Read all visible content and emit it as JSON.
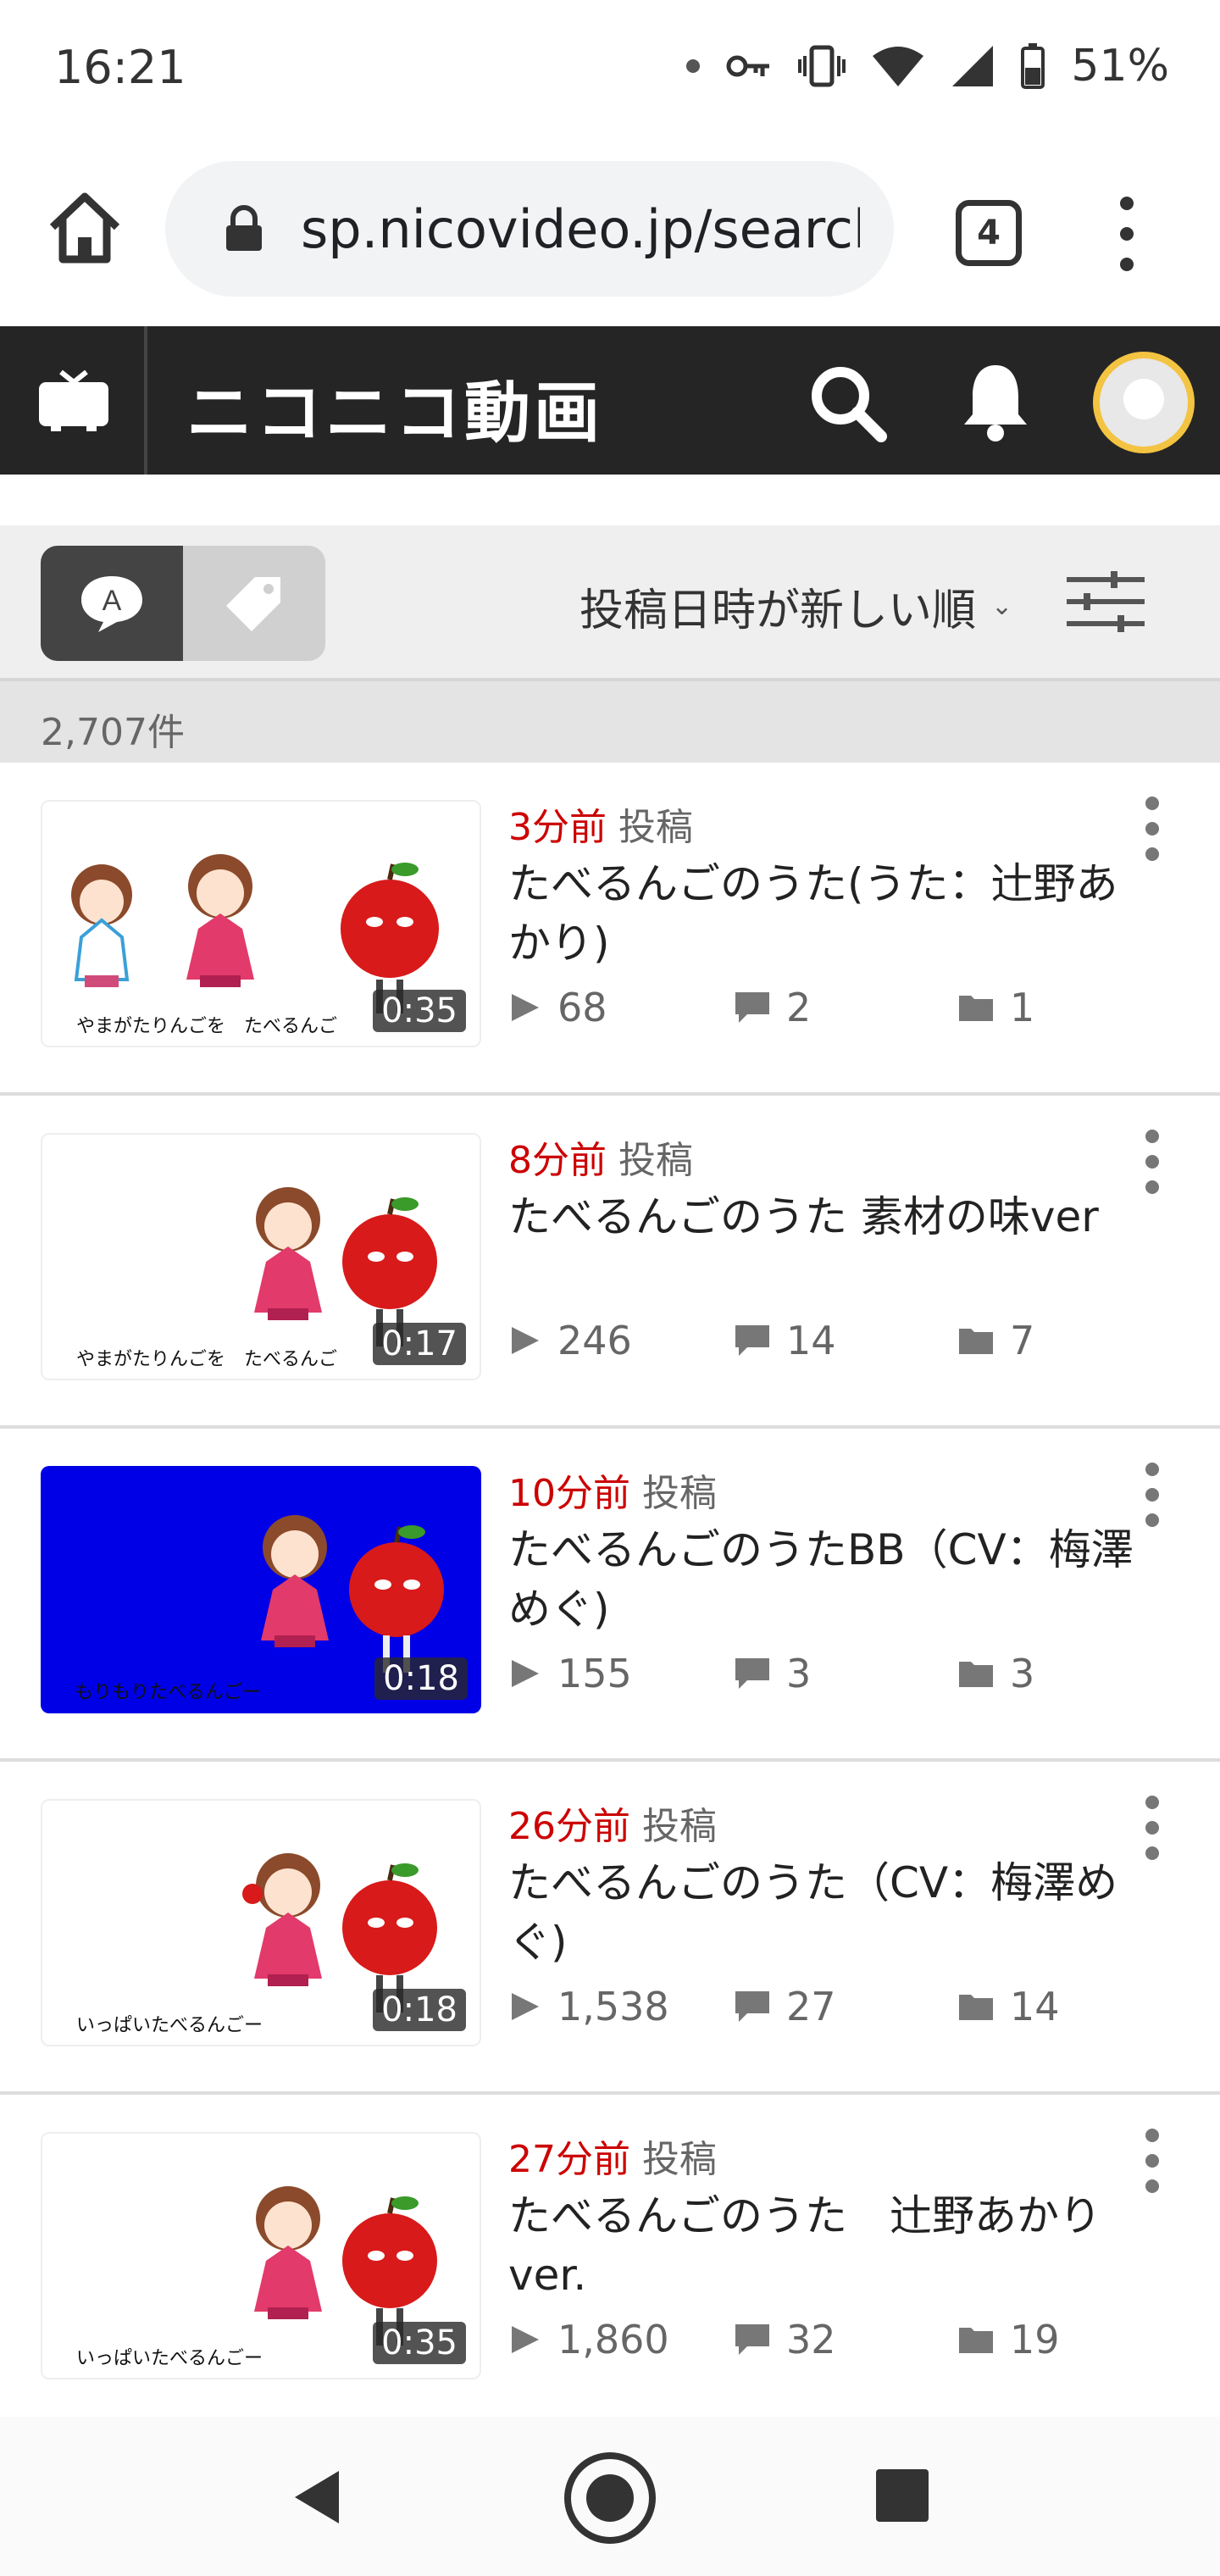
{
  "status_bar": {
    "time": "16:21",
    "battery": "51%",
    "icons": [
      "dot-icon",
      "key-icon",
      "vibrate-icon",
      "wifi-icon",
      "signal-icon",
      "battery-icon"
    ]
  },
  "browser": {
    "url": "sp.nicovideo.jp/search/",
    "tab_count": "4"
  },
  "header": {
    "site_title": "ニコニコ動画",
    "accent_color": "#252525"
  },
  "filter": {
    "sort_label": "投稿日時が新しい順",
    "search_mode_selected": "keyword"
  },
  "results": {
    "count_label": "2,707件",
    "items": [
      {
        "ago": "3分前",
        "posted": "投稿",
        "title": "たべるんごのうた(うた：辻野あかり)",
        "views": "68",
        "comments": "2",
        "mylists": "1",
        "duration": "0:35"
      },
      {
        "ago": "8分前",
        "posted": "投稿",
        "title": "たべるんごのうた 素材の味ver",
        "views": "246",
        "comments": "14",
        "mylists": "7",
        "duration": "0:17"
      },
      {
        "ago": "10分前",
        "posted": "投稿",
        "title": "たべるんごのうたBB（CV：梅澤めぐ)",
        "views": "155",
        "comments": "3",
        "mylists": "3",
        "duration": "0:18"
      },
      {
        "ago": "26分前",
        "posted": "投稿",
        "title": "たべるんごのうた（CV：梅澤めぐ)",
        "views": "1,538",
        "comments": "27",
        "mylists": "14",
        "duration": "0:18"
      },
      {
        "ago": "27分前",
        "posted": "投稿",
        "title": "たべるんごのうた　辻野あかりver.",
        "views": "1,860",
        "comments": "32",
        "mylists": "19",
        "duration": "0:35"
      }
    ]
  },
  "colors": {
    "time_red": "#cc0000",
    "thumb_blue": "#0000e6",
    "avatar_ring": "#f3c342"
  }
}
